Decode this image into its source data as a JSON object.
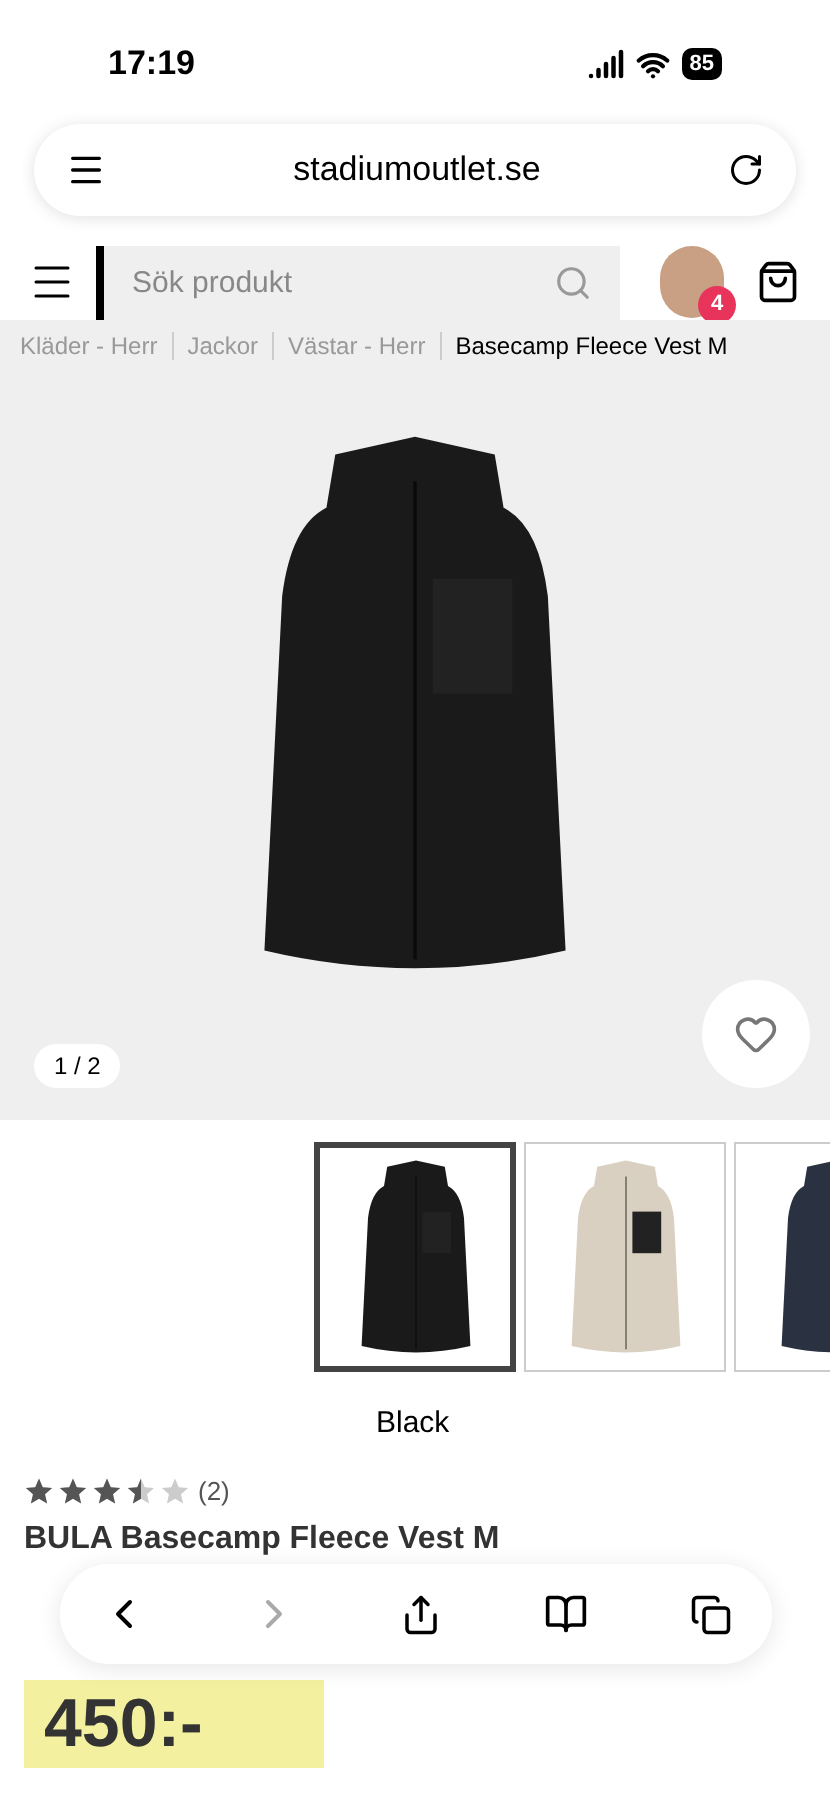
{
  "status_bar": {
    "time": "17:19",
    "battery": "85"
  },
  "browser": {
    "url": "stadiumoutlet.se"
  },
  "header": {
    "search": {
      "placeholder": "Sök produkt"
    },
    "cart_badge": "4"
  },
  "breadcrumb": [
    "Kläder - Herr",
    "Jackor",
    "Västar - Herr",
    "Basecamp Fleece Vest M"
  ],
  "gallery": {
    "counter": "1 / 2",
    "favorite": false
  },
  "variants": [
    {
      "color": "#1a1a1a",
      "selected": true
    },
    {
      "color": "#d9d0c1",
      "selected": false
    },
    {
      "color": "#2a3140",
      "selected": false
    }
  ],
  "variant_label": "Black",
  "product": {
    "stars": 3.5,
    "review_count": "(2)",
    "title": "BULA Basecamp Fleece Vest M",
    "price": "450:-"
  }
}
